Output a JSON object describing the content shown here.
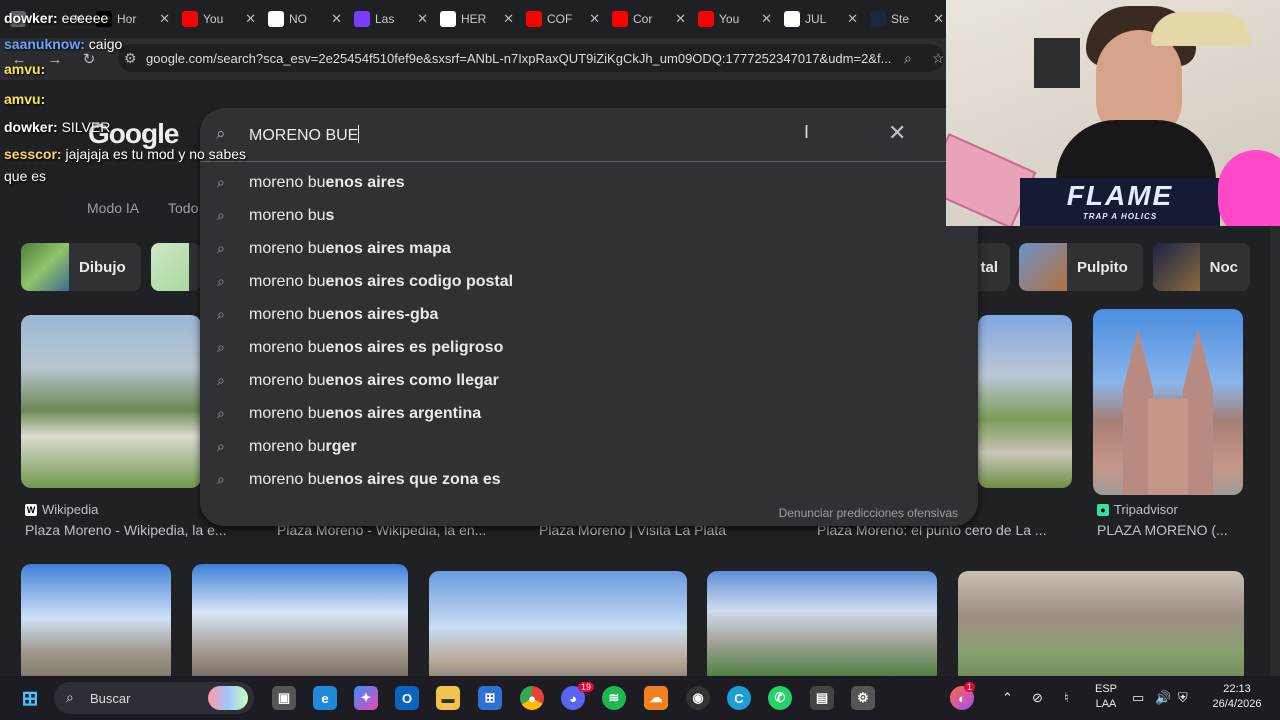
{
  "browser": {
    "tabs": [
      {
        "label": "",
        "icon": "globe-icon",
        "color": "#5f6368"
      },
      {
        "label": "Hor",
        "icon": "x-logo-icon",
        "color": "#000000"
      },
      {
        "label": "You",
        "icon": "youtube-icon",
        "color": "#ff0000"
      },
      {
        "label": "NO",
        "icon": "google-icon",
        "color": "#ffffff"
      },
      {
        "label": "Las",
        "icon": "slash-icon",
        "color": "#7a3cff"
      },
      {
        "label": "HER",
        "icon": "google-icon",
        "color": "#ffffff"
      },
      {
        "label": "COF",
        "icon": "youtube-icon",
        "color": "#ff0000"
      },
      {
        "label": "Cor",
        "icon": "youtube-icon",
        "color": "#ff0000"
      },
      {
        "label": "You",
        "icon": "youtube-icon",
        "color": "#ff0000"
      },
      {
        "label": "JUL",
        "icon": "google-icon",
        "color": "#ffffff"
      },
      {
        "label": "Ste",
        "icon": "steam-icon",
        "color": "#1b2838"
      }
    ],
    "url": "google.com/search?sca_esv=2e25454f510fef9e&sxsrf=ANbL-n7IxpRaxQUT9iZiKgCkJh_um09ODQ:1777252347017&udm=2&f..."
  },
  "google": {
    "logo": "Google",
    "search": {
      "query": "MORENO BUE",
      "suggestions": [
        {
          "prefix": "moreno bu",
          "suffix": "enos aires"
        },
        {
          "prefix": "moreno bu",
          "suffix": "s"
        },
        {
          "prefix": "moreno bu",
          "suffix": "enos aires mapa"
        },
        {
          "prefix": "moreno bu",
          "suffix": "enos aires codigo postal"
        },
        {
          "prefix": "moreno bu",
          "suffix": "enos aires-gba"
        },
        {
          "prefix": "moreno bu",
          "suffix": "enos aires es peligroso"
        },
        {
          "prefix": "moreno bu",
          "suffix": "enos aires como llegar"
        },
        {
          "prefix": "moreno bu",
          "suffix": "enos aires argentina"
        },
        {
          "prefix": "moreno bu",
          "suffix": "rger"
        },
        {
          "prefix": "moreno bu",
          "suffix": "enos aires que zona es"
        }
      ],
      "report_link": "Denunciar predicciones ofensivas"
    },
    "filters": [
      "Modo IA",
      "Todo"
    ],
    "chips": [
      "Dibujo",
      "tal",
      "Pulpito",
      "Noc"
    ],
    "results": [
      {
        "source": "Wikipedia",
        "caption": "Plaza Moreno - Wikipedia, la e..."
      },
      {
        "source": "",
        "caption": "Plaza Moreno - Wikipedia, la en..."
      },
      {
        "source": "",
        "caption": "Plaza Moreno | Visita La Plata"
      },
      {
        "source": "",
        "caption": "Plaza Moreno: el punto cero de La ..."
      },
      {
        "source": "Tripadvisor",
        "caption": "PLAZA MORENO (..."
      }
    ]
  },
  "chat": [
    {
      "user": "dowker:",
      "msg": "eeeeee",
      "color": "#ffffff"
    },
    {
      "user": "saanuknow:",
      "msg": "caigo",
      "color": "#6aa6ff"
    },
    {
      "user": "amvu:",
      "msg": "",
      "color": "#ffe44a"
    },
    {
      "user": "amvu:",
      "msg": "",
      "color": "#ffe44a"
    },
    {
      "user": "dowker:",
      "msg": "SILVER",
      "color": "#ffffff"
    },
    {
      "user": "sesscor:",
      "msg": "jajajaja es tu mod y no sabes",
      "color": "#ffd36a"
    },
    {
      "user": "",
      "msg": "que es",
      "color": "#ffffff"
    }
  ],
  "webcam": {
    "banner": "FLAME",
    "banner_sub": "TRAP A HOLICS"
  },
  "taskbar": {
    "search_placeholder": "Buscar",
    "lang": "ESP",
    "region": "LAA",
    "time": "22:13",
    "date": "26/4/2026",
    "badge_discord": "19",
    "badge_tray": "1"
  }
}
